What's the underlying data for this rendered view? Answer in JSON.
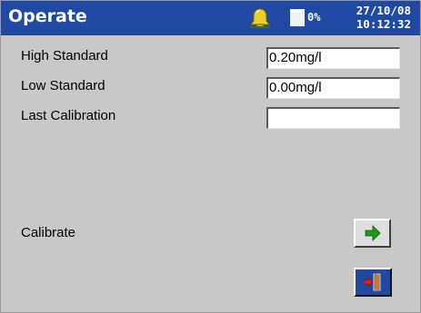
{
  "header": {
    "title": "Operate",
    "bell_icon": "bell-icon",
    "storage_icon": "memory-card-icon",
    "storage_percent": "0%",
    "date": "27/10/08",
    "time": "10:12:32",
    "bar_color": "#1f49a3"
  },
  "fields": [
    {
      "label": "High Standard",
      "value": "0.20mg/l"
    },
    {
      "label": "Low Standard",
      "value": "0.00mg/l"
    },
    {
      "label": "Last Calibration",
      "value": ""
    }
  ],
  "calibrate": {
    "label": "Calibrate",
    "icon": "right-arrow-icon",
    "arrow_color": "#1a9a1a"
  },
  "exit": {
    "icon": "exit-door-icon"
  }
}
